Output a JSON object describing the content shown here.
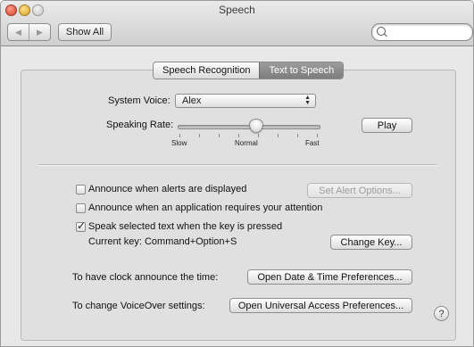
{
  "window": {
    "title": "Speech",
    "show_all_label": "Show All",
    "search": {
      "value": "",
      "placeholder": ""
    }
  },
  "tabs": [
    {
      "label": "Speech Recognition",
      "active": false
    },
    {
      "label": "Text to Speech",
      "active": true
    }
  ],
  "voice": {
    "label": "System Voice:",
    "selected": "Alex"
  },
  "rate": {
    "label": "Speaking Rate:",
    "slow": "Slow",
    "normal": "Normal",
    "fast": "Fast",
    "value_fraction": 0.55,
    "play_label": "Play"
  },
  "options": {
    "alerts": {
      "label": "Announce when alerts are displayed",
      "checked": false,
      "button": "Set Alert Options..."
    },
    "attention": {
      "label": "Announce when an application requires your attention",
      "checked": false
    },
    "speak": {
      "label": "Speak selected text when the key is pressed",
      "checked": true
    },
    "current_key": "Current key: Command+Option+S",
    "change_key": "Change Key..."
  },
  "clock": {
    "label": "To have clock announce the time:",
    "button": "Open Date & Time Preferences..."
  },
  "voiceover": {
    "label": "To change VoiceOver settings:",
    "button": "Open Universal Access Preferences..."
  },
  "help_label": "?",
  "colors": {
    "active_tab": "#8a8a8a",
    "background": "#e8e8e8"
  }
}
